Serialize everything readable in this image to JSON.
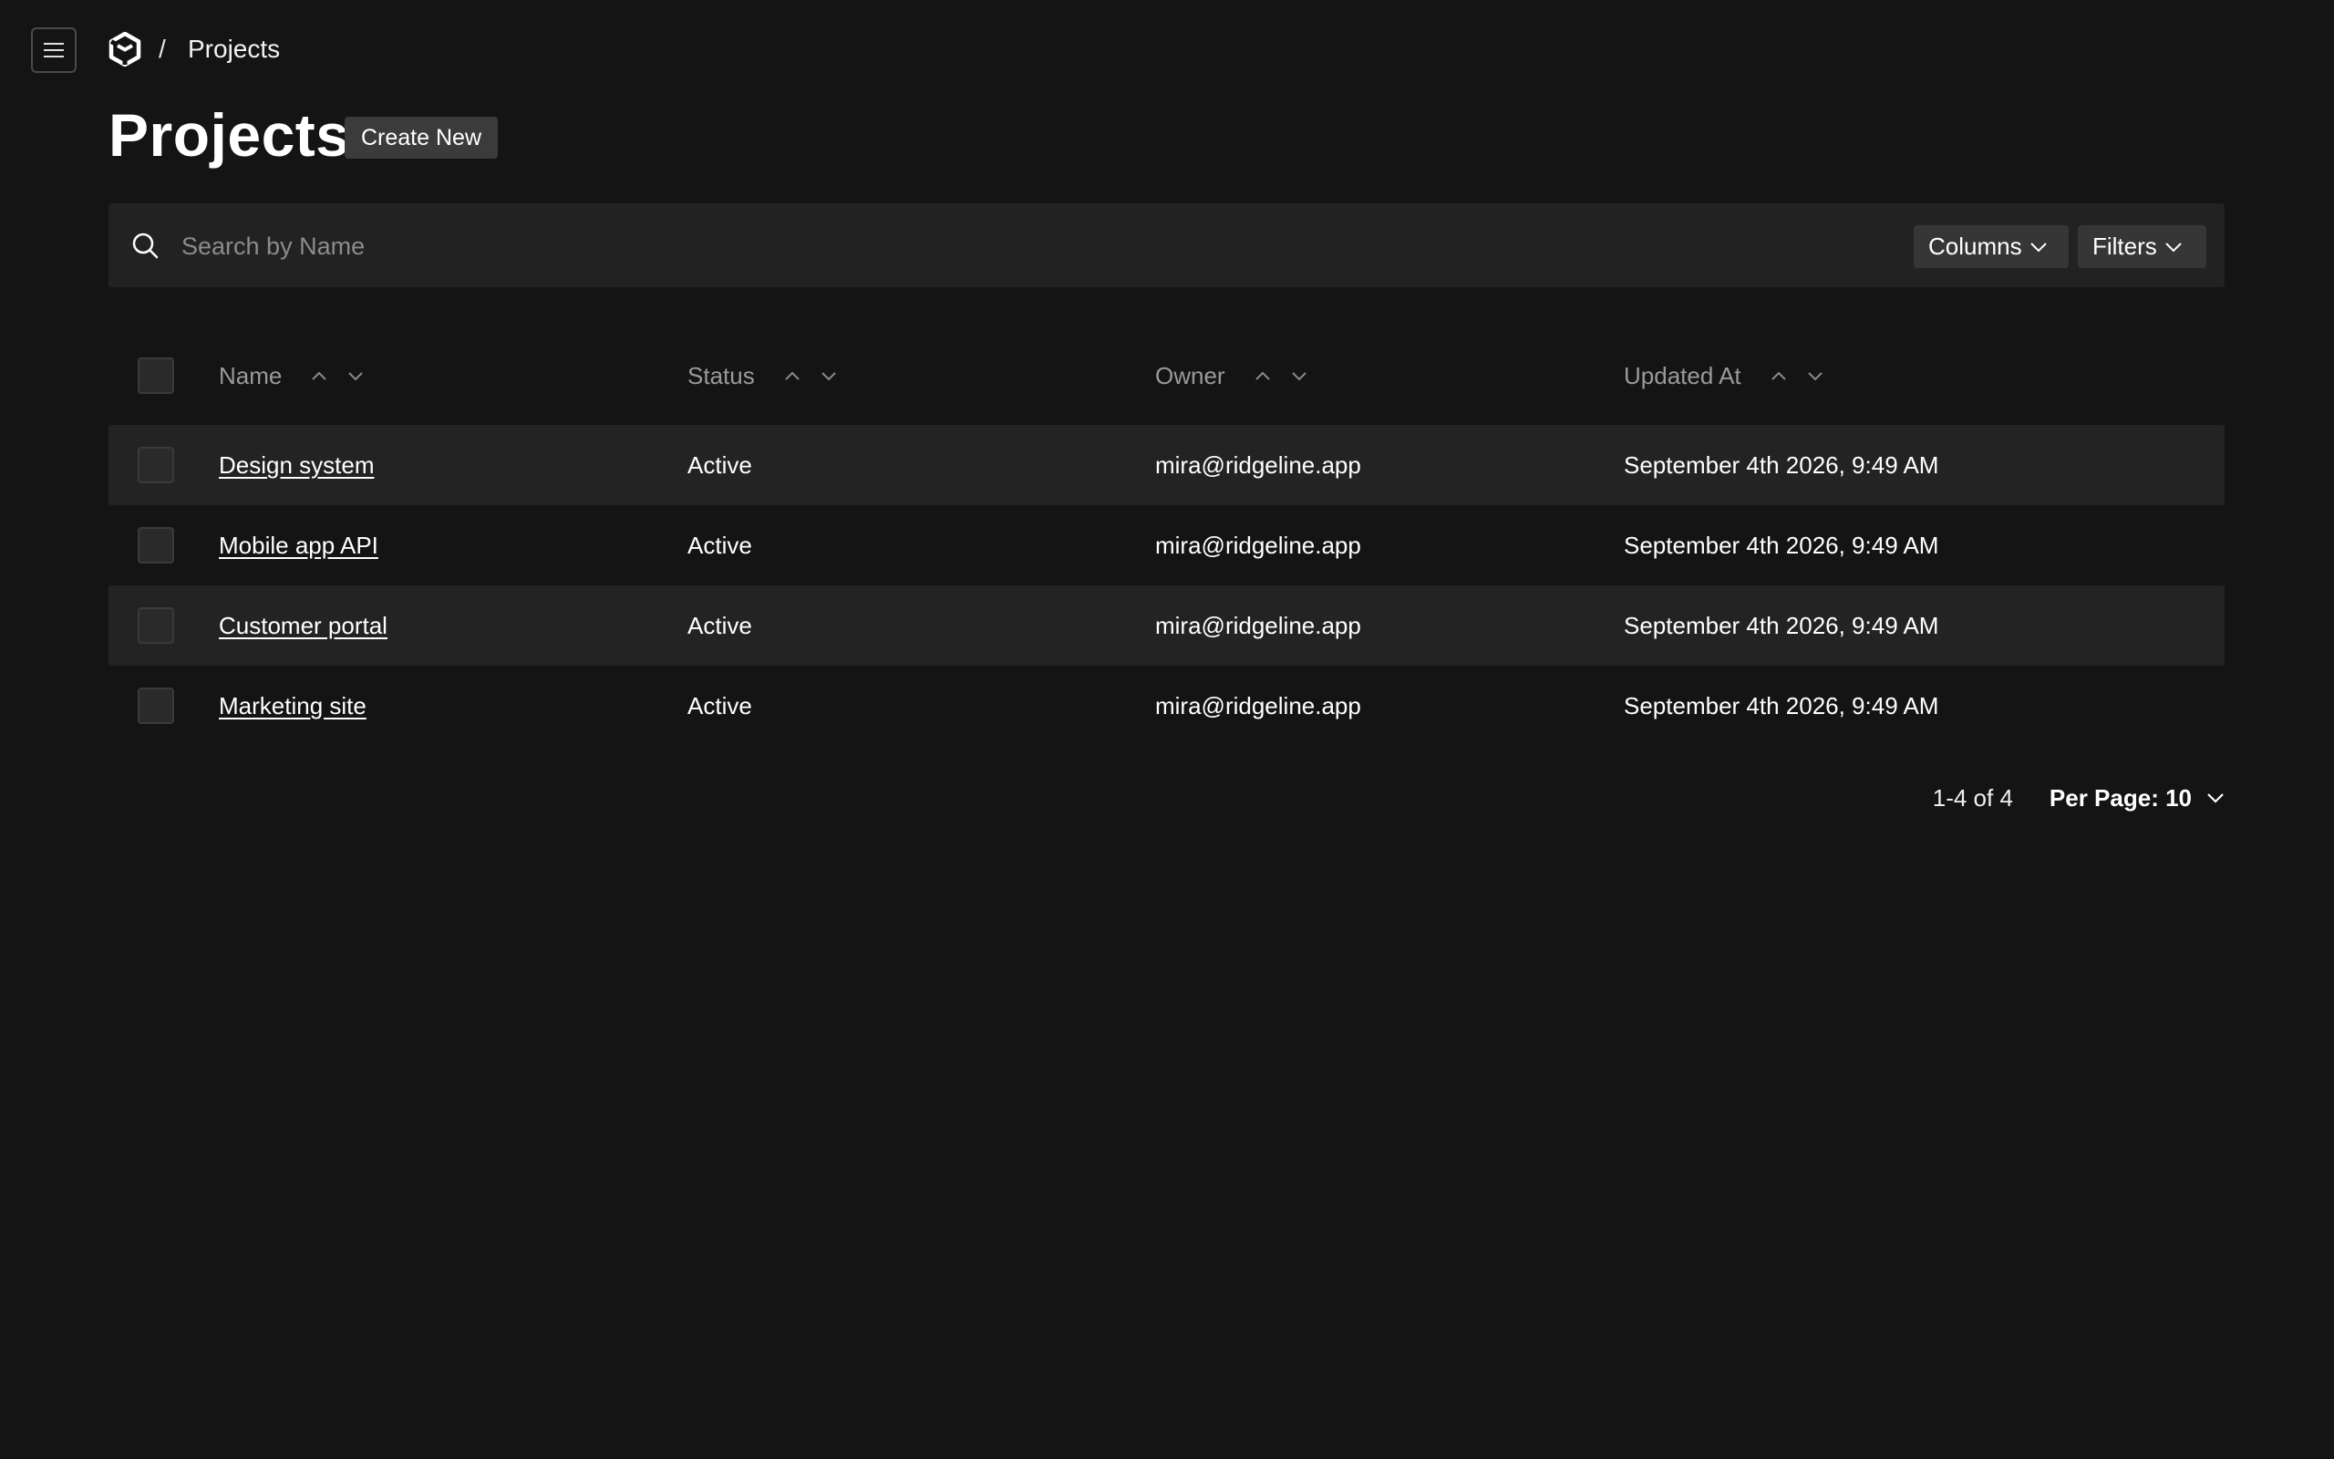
{
  "breadcrumb": {
    "separator": "/",
    "current": "Projects"
  },
  "header": {
    "title": "Projects",
    "create_label": "Create New"
  },
  "search": {
    "placeholder": "Search by Name",
    "value": "",
    "columns_label": "Columns",
    "filters_label": "Filters"
  },
  "table": {
    "columns": [
      "Name",
      "Status",
      "Owner",
      "Updated At"
    ],
    "rows": [
      {
        "name": "Design system",
        "status": "Active",
        "owner": "mira@ridgeline.app",
        "updated": "September 4th 2026, 9:49 AM"
      },
      {
        "name": "Mobile app API",
        "status": "Active",
        "owner": "mira@ridgeline.app",
        "updated": "September 4th 2026, 9:49 AM"
      },
      {
        "name": "Customer portal",
        "status": "Active",
        "owner": "mira@ridgeline.app",
        "updated": "September 4th 2026, 9:49 AM"
      },
      {
        "name": "Marketing site",
        "status": "Active",
        "owner": "mira@ridgeline.app",
        "updated": "September 4th 2026, 9:49 AM"
      }
    ]
  },
  "pagination": {
    "range": "1-4 of 4",
    "per_page": "Per Page: 10"
  },
  "icons": {
    "menu": "hamburger-menu-icon",
    "logo": "hexagon-logo-icon",
    "search": "search-icon",
    "sort_asc": "chevron-up-icon",
    "sort_desc": "chevron-down-icon"
  },
  "colors": {
    "background": "#141414",
    "surface": "#222222",
    "striped_row": "#232323",
    "button": "#3b3b3b",
    "muted_text": "#9a9a9a"
  }
}
